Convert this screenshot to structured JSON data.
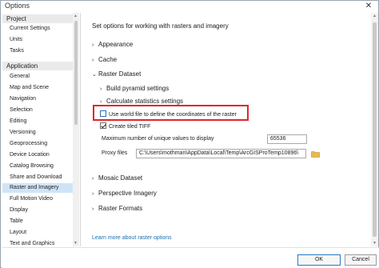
{
  "window": {
    "title": "Options",
    "close_glyph": "✕"
  },
  "sidebar": {
    "groups": [
      {
        "label": "Project",
        "items": [
          "Current Settings",
          "Units",
          "Tasks"
        ]
      },
      {
        "label": "Application",
        "items": [
          "General",
          "Map and Scene",
          "Navigation",
          "Selection",
          "Editing",
          "Versioning",
          "Geoprocessing",
          "Device Location",
          "Catalog Browsing",
          "Share and Download",
          "Raster and Imagery",
          "Full Motion Video",
          "Display",
          "Table",
          "Layout",
          "Text and Graphics"
        ]
      }
    ],
    "selected": "Raster and Imagery"
  },
  "main": {
    "heading": "Set options for working with rasters and imagery",
    "sections": {
      "appearance": "Appearance",
      "cache": "Cache",
      "raster_dataset": "Raster Dataset",
      "build_pyramid": "Build pyramid settings",
      "calc_stats": "Calculate statistics settings",
      "mosaic_dataset": "Mosaic Dataset",
      "perspective_imagery": "Perspective Imagery",
      "raster_formats": "Raster Formats"
    },
    "checkboxes": {
      "world_file": {
        "label": "Use world file to define the coordinates of the raster",
        "checked": false
      },
      "tiled_tiff": {
        "label": "Create tiled TIFF",
        "checked": true
      }
    },
    "fields": {
      "max_unique_label": "Maximum number of unique values to display",
      "max_unique_value": "65536",
      "proxy_label": "Proxy files",
      "proxy_value": "C:\\Users\\mothman\\AppData\\Local\\Temp\\ArcGISProTemp10896\\"
    },
    "learn_more": "Learn more about raster options"
  },
  "icons": {
    "chevron_collapsed": "chevron-right-icon",
    "chevron_expanded": "chevron-down-icon",
    "folder": "folder-icon",
    "close": "close-icon"
  },
  "colors": {
    "selection": "#cfe4f7",
    "highlight_box": "#e0262b",
    "link": "#1a6fb0",
    "folder": "#e8b94a"
  },
  "footer": {
    "ok_label": "OK",
    "cancel_label": "Cancel"
  }
}
